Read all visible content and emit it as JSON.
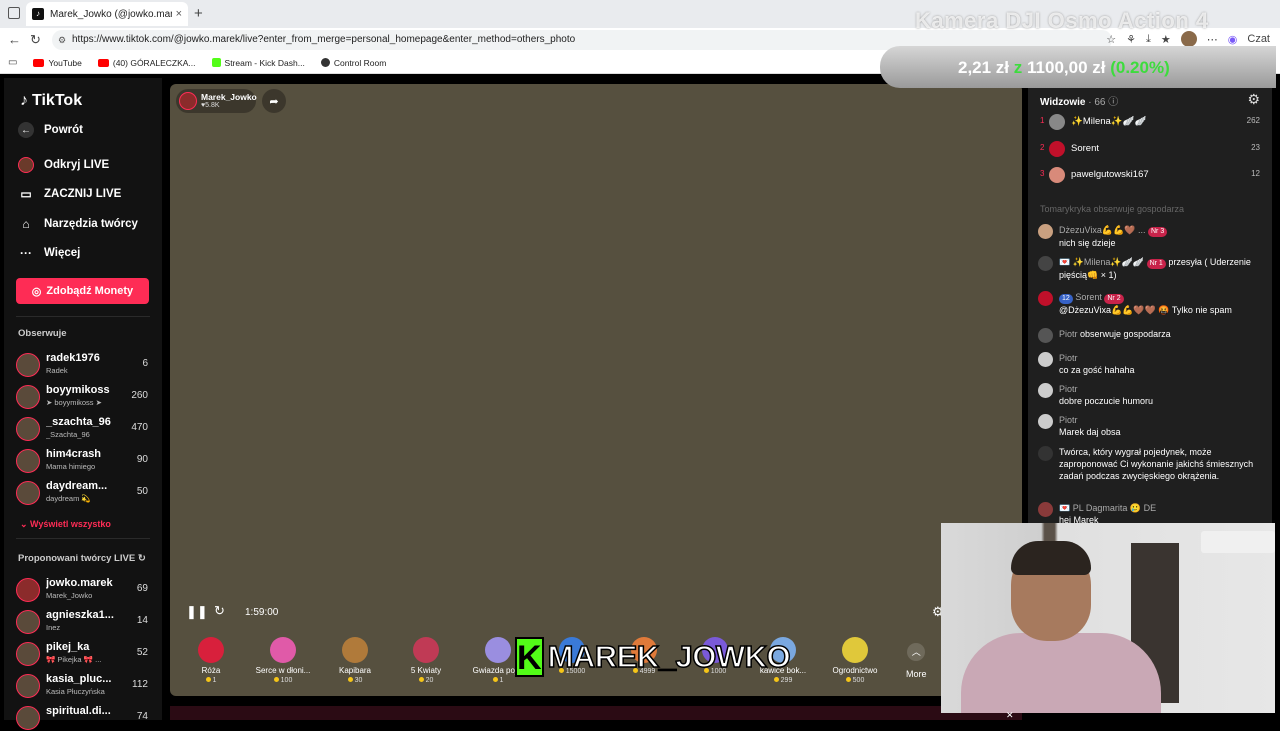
{
  "browser": {
    "tab_title": "Marek_Jowko (@jowko.marek) pro",
    "tab_close": "×",
    "new_tab": "+",
    "url": "https://www.tiktok.com/@jowko.marek/live?enter_from_merge=personal_homepage&enter_method=others_photo",
    "chat_label": "Czat",
    "bookmarks": [
      {
        "label": "YouTube",
        "color": "#ff0000"
      },
      {
        "label": "(40) GÓRALECZKA...",
        "color": "#ff0000"
      },
      {
        "label": "Stream - Kick Dash...",
        "color": "#53fc18"
      },
      {
        "label": "Control Room",
        "color": "#333333"
      }
    ]
  },
  "overlay": {
    "title": "Kamera DJI Osmo Action 4",
    "price_a": "2,21 zł",
    "price_b": "1100,00 zł",
    "price_pct": "(0.20%)",
    "kick_letter": "K",
    "kick_name": "MAREK_JOWKO"
  },
  "sidebar": {
    "logo": "TikTok",
    "back": "Powrót",
    "nav": [
      "Odkryj LIVE",
      "ZACZNIJ LIVE",
      "Narzędzia twórcy",
      "Więcej"
    ],
    "coins_button": "Zdobądź Monety",
    "following_title": "Obserwuje",
    "following": [
      {
        "name": "radek1976",
        "sub": "Radek",
        "count": "6"
      },
      {
        "name": "boyymikoss",
        "sub": "➤ boyymikoss ➤",
        "count": "260"
      },
      {
        "name": "_szachta_96",
        "sub": "_Szachta_96",
        "count": "470"
      },
      {
        "name": "him4crash",
        "sub": "Mama himiego",
        "count": "90"
      },
      {
        "name": "daydream...",
        "sub": "daydream 💫",
        "count": "50"
      }
    ],
    "show_all": "Wyświetl wszystko",
    "suggested_title": "Proponowani twórcy LIVE",
    "suggested": [
      {
        "name": "jowko.marek",
        "sub": "Marek_Jowko",
        "count": "69"
      },
      {
        "name": "agnieszka1...",
        "sub": "Inez",
        "count": "14"
      },
      {
        "name": "pikej_ka",
        "sub": "🎀 Pikejka 🎀 ...",
        "count": "52"
      },
      {
        "name": "kasia_pluc...",
        "sub": "Kasia Płuczyńska",
        "count": "112"
      },
      {
        "name": "spiritual.di...",
        "sub": "",
        "count": "74"
      }
    ]
  },
  "video": {
    "host_name": "Marek_Jowko",
    "host_viewers": "5.8K",
    "time": "1:59:00",
    "more": "More",
    "gifts": [
      {
        "name": "Róża",
        "price": "1",
        "color": "#d8203c"
      },
      {
        "name": "Serce w dłoni...",
        "price": "100",
        "color": "#e05aa8"
      },
      {
        "name": "Kapibara",
        "price": "30",
        "color": "#b07a3a"
      },
      {
        "name": "5 Kwiaty",
        "price": "20",
        "color": "#c03a55"
      },
      {
        "name": "Gwiazda poj...",
        "price": "1",
        "color": "#9a8ee0"
      },
      {
        "name": "",
        "price": "15000",
        "color": "#3a7ad8"
      },
      {
        "name": "",
        "price": "4999",
        "color": "#e07a3a"
      },
      {
        "name": "",
        "price": "1000",
        "color": "#7a5ad8"
      },
      {
        "name": "kawice bok...",
        "price": "299",
        "color": "#7aa8e0"
      },
      {
        "name": "Ogrodnictwo",
        "price": "500",
        "color": "#e0c83a"
      }
    ]
  },
  "right_panel": {
    "title": "Widzowie",
    "count": "· 66",
    "viewers": [
      {
        "rank": "1",
        "name": "✨Milena✨🪽🪽",
        "score": "262",
        "color": "#888"
      },
      {
        "rank": "2",
        "name": "Sorent",
        "score": "23",
        "color": "#c0102a"
      },
      {
        "rank": "3",
        "name": "pawelgutowski167",
        "score": "12",
        "color": "#d88a7a"
      }
    ],
    "faded": "Tomarykryka obserwuje gospodarza",
    "messages": [
      {
        "user": "DżezuVixa💪💪🤎 ...",
        "badge": "Nr 3",
        "text": "nich się dzieje",
        "color": "#c9a080"
      },
      {
        "user": "💌 ✨Milena✨🪽🪽",
        "badge": "Nr 1",
        "text": "przesyła ( Uderzenie pięścią👊 × 1)",
        "color": "#444"
      },
      {
        "user": "Sorent",
        "badge": "Nr 2",
        "level": "12",
        "text": "@DżezuVixa💪💪🤎🤎 🤬 Tylko nie spam",
        "color": "#c0102a"
      },
      {
        "user": "Piotr",
        "badge": "",
        "text": "obserwuje gospodarza",
        "color": "#555"
      },
      {
        "user": "Piotr",
        "badge": "",
        "text": "co za gość hahaha",
        "color": "#ccc"
      },
      {
        "user": "Piotr",
        "badge": "",
        "text": "dobre poczucie humoru",
        "color": "#ccc"
      },
      {
        "user": "Piotr",
        "badge": "",
        "text": "Marek daj obsa",
        "color": "#ccc"
      },
      {
        "user": "",
        "badge": "",
        "text": "Twórca, który wygrał pojedynek, może zaproponować Ci wykonanie jakichś śmiesznych zadań podczas zwycięskiego okrążenia.",
        "color": "#333"
      },
      {
        "user": "💌 PL Dagmarita 🥲 DE",
        "badge": "",
        "text": "hej Marek",
        "color": "#8a3a3a"
      }
    ]
  }
}
